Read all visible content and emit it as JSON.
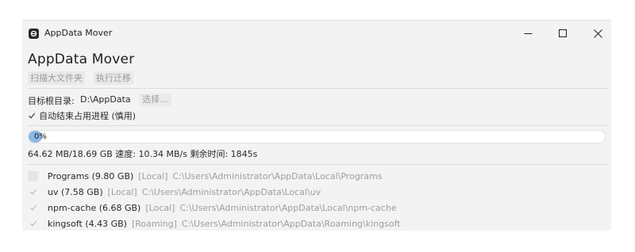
{
  "window": {
    "title": "AppData Mover"
  },
  "app": {
    "heading": "AppData Mover",
    "tabs": [
      {
        "label": "扫描大文件夹"
      },
      {
        "label": "执行迁移"
      }
    ]
  },
  "target": {
    "label": "目标根目录:",
    "path": "D:\\AppData",
    "select_label": "选择..."
  },
  "autokill": {
    "label": "自动结束占用进程 (慎用)",
    "checked": true
  },
  "progress": {
    "percent_text": "0%",
    "fraction": 0.0,
    "stats": "64.62 MB/18.69 GB  速度: 10.34 MB/s  剩余时间: 1845s"
  },
  "folders": [
    {
      "name": "Programs (9.80 GB)",
      "tag": "[Local]",
      "path": "C:\\Users\\Administrator\\AppData\\Local\\Programs",
      "checked": false
    },
    {
      "name": "uv (7.58 GB)",
      "tag": "[Local]",
      "path": "C:\\Users\\Administrator\\AppData\\Local\\uv",
      "checked": true
    },
    {
      "name": "npm-cache (6.68 GB)",
      "tag": "[Local]",
      "path": "C:\\Users\\Administrator\\AppData\\Local\\npm-cache",
      "checked": true
    },
    {
      "name": "kingsoft (4.43 GB)",
      "tag": "[Roaming]",
      "path": "C:\\Users\\Administrator\\AppData\\Roaming\\kingsoft",
      "checked": true
    }
  ],
  "colors": {
    "window_bg": "#f3f3f3",
    "progress_fill": "#8ab8e6",
    "muted_text": "#9e9e9e"
  },
  "icons": {
    "app": "app-logo-icon",
    "minimize": "minimize-icon",
    "maximize": "maximize-icon",
    "close": "close-icon",
    "check": "checkmark-icon"
  }
}
